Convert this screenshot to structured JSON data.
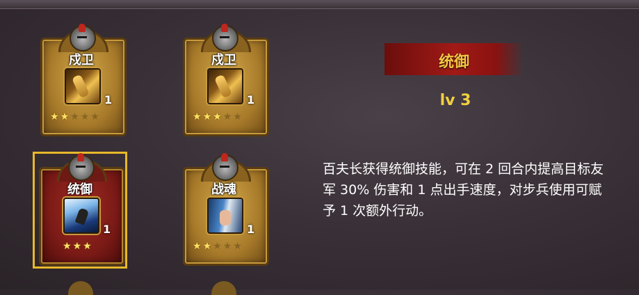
{
  "skills": [
    {
      "name": "戍卫",
      "count": "1",
      "stars_filled": 2,
      "stars_total": 5,
      "style": "gold",
      "icon": "arm-gauntlet-icon"
    },
    {
      "name": "戍卫",
      "count": "1",
      "stars_filled": 3,
      "stars_total": 5,
      "style": "gold",
      "icon": "arm-gauntlet-icon"
    },
    {
      "name": "统御",
      "count": "1",
      "stars_filled": 3,
      "stars_total": 3,
      "style": "red",
      "icon": "commander-icon",
      "selected": true
    },
    {
      "name": "战魂",
      "count": "1",
      "stars_filled": 2,
      "stars_total": 5,
      "style": "gold",
      "icon": "sword-hand-icon"
    }
  ],
  "detail": {
    "title": "统御",
    "level": "lv 3",
    "description": "百夫长获得统御技能，可在 2 回合内提高目标友军 30% 伤害和 1 点出手速度，对步兵使用可赋予 1 次额外行动。"
  },
  "colors": {
    "gold": "#f5c542",
    "selected_border": "#e8b82a",
    "banner": "#a11a16"
  }
}
